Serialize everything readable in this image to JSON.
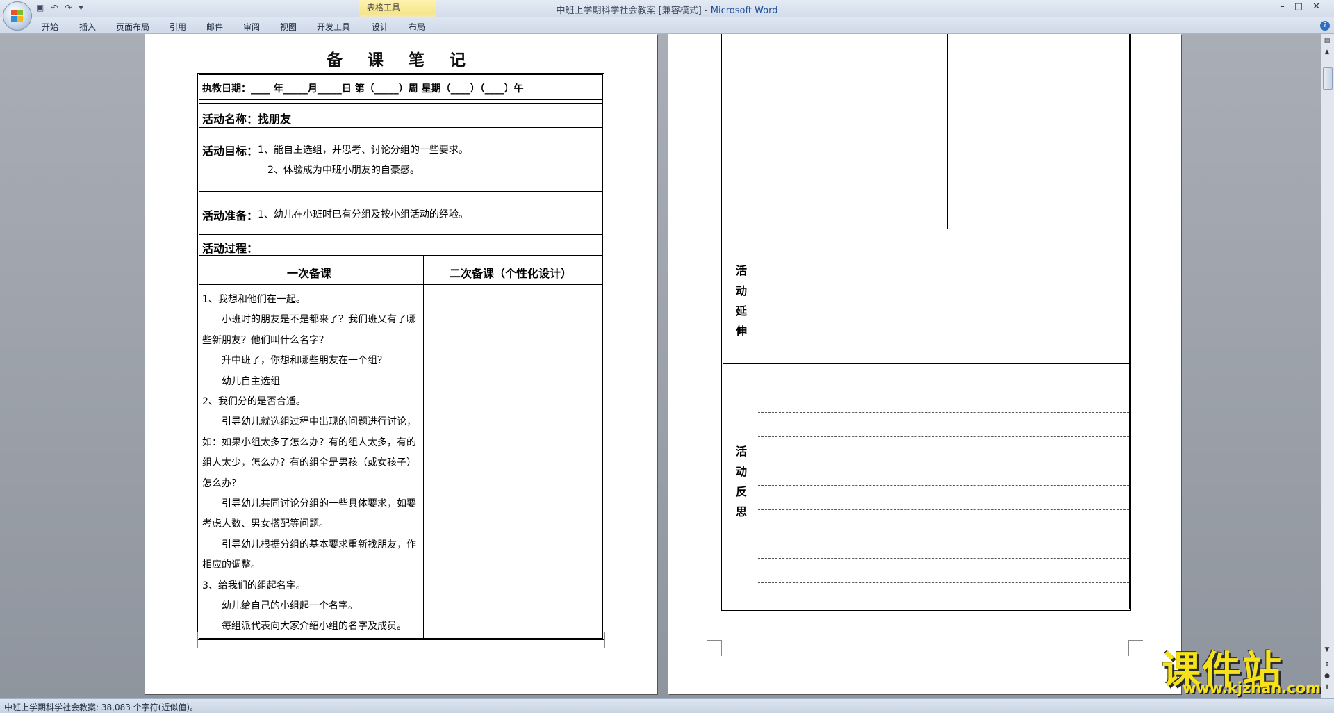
{
  "window": {
    "title_doc": "中班上学期科学社会教案 [兼容模式]",
    "title_sep": " - ",
    "title_app": "Microsoft Word",
    "contextual_group": "表格工具"
  },
  "ribbon": {
    "tabs": [
      "开始",
      "插入",
      "页面布局",
      "引用",
      "邮件",
      "审阅",
      "视图",
      "开发工具",
      "设计",
      "布局"
    ]
  },
  "status": {
    "text": "中班上学期科学社会教案: 38,083 个字符(近似值)。"
  },
  "page1": {
    "title": "备 课 笔 记",
    "date_row": "执教日期：____ 年_____月_____日        第（_____）周    星期（____）（____）午",
    "activity_name_label": "活动名称：",
    "activity_name": "找朋友",
    "goals_label": "活动目标：",
    "goal1": "1、能自主选组，并思考、讨论分组的一些要求。",
    "goal2": "2、体验成为中班小朋友的自豪感。",
    "prep_label": "活动准备：",
    "prep1": "1、幼儿在小班时已有分组及按小组活动的经验。",
    "process_label": "活动过程：",
    "col1_header": "一次备课",
    "col2_header": "二次备课（个性化设计）",
    "body": [
      "1、我想和他们在一起。",
      "　　小班时的朋友是不是都来了？我们班又有了哪",
      "些新朋友？他们叫什么名字？",
      "　　升中班了，你想和哪些朋友在一个组？",
      "　　幼儿自主选组",
      "2、我们分的是否合适。",
      "　　引导幼儿就选组过程中出现的问题进行讨论，",
      "如：如果小组太多了怎么办？有的组人太多，有的",
      "组人太少，怎么办？有的组全是男孩（或女孩子）",
      "怎么办？",
      "　　引导幼儿共同讨论分组的一些具体要求，如要",
      "考虑人数、男女搭配等问题。",
      "　　引导幼儿根据分组的基本要求重新找朋友，作",
      "相应的调整。",
      "3、给我们的组起名字。",
      "　　幼儿给自己的小组起一个名字。",
      "　　每组派代表向大家介绍小组的名字及成员。"
    ]
  },
  "page2": {
    "extension_label": [
      "活",
      "动",
      "延",
      "伸"
    ],
    "reflection_label": [
      "活",
      "动",
      "反",
      "思"
    ]
  },
  "watermark": {
    "brand": "课件站",
    "url": "www.kjzhan.com"
  }
}
